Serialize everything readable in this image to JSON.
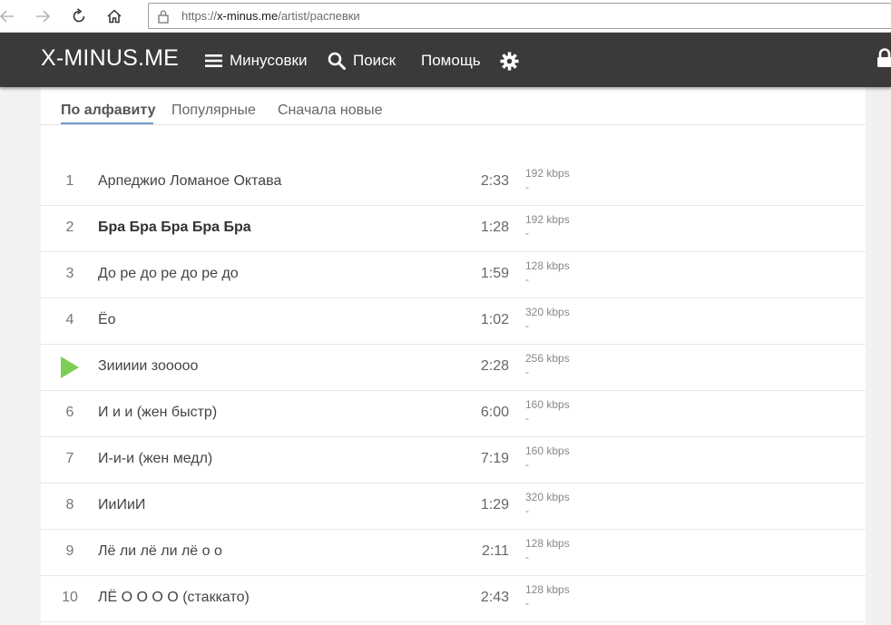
{
  "browser": {
    "url_scheme": "https://",
    "url_host": "x-minus.me",
    "url_path": "/artist/распевки"
  },
  "header": {
    "logo": "X-MINUS.ME",
    "nav": [
      {
        "label": "Минусовки",
        "icon": "menu-icon"
      },
      {
        "label": "Поиск",
        "icon": "search-icon"
      },
      {
        "label": "Помощь"
      }
    ],
    "settings_icon": "gear-icon",
    "lock_icon": "lock-icon"
  },
  "sort_tabs": [
    {
      "label": "По алфавиту",
      "active": true
    },
    {
      "label": "Популярные",
      "active": false
    },
    {
      "label": "Сначала новые",
      "active": false
    }
  ],
  "tracks": [
    {
      "num": "1",
      "title": "Арпеджио Ломаное Октава",
      "duration": "2:33",
      "bitrate": "192 kbps",
      "extra": "-",
      "bold": false,
      "playing": false
    },
    {
      "num": "2",
      "title": "Бра Бра Бра Бра Бра",
      "duration": "1:28",
      "bitrate": "192 kbps",
      "extra": "-",
      "bold": true,
      "playing": false
    },
    {
      "num": "3",
      "title": "До ре до ре до ре до",
      "duration": "1:59",
      "bitrate": "128 kbps",
      "extra": "-",
      "bold": false,
      "playing": false
    },
    {
      "num": "4",
      "title": "Ёо",
      "duration": "1:02",
      "bitrate": "320 kbps",
      "extra": "-",
      "bold": false,
      "playing": false
    },
    {
      "num": "",
      "title": "Зиииии зооооо",
      "duration": "2:28",
      "bitrate": "256 kbps",
      "extra": "-",
      "bold": false,
      "playing": true
    },
    {
      "num": "6",
      "title": "И и и (жен быстр)",
      "duration": "6:00",
      "bitrate": "160 kbps",
      "extra": "-",
      "bold": false,
      "playing": false
    },
    {
      "num": "7",
      "title": "И-и-и (жен медл)",
      "duration": "7:19",
      "bitrate": "160 kbps",
      "extra": "-",
      "bold": false,
      "playing": false
    },
    {
      "num": "8",
      "title": "ИиИиИ",
      "duration": "1:29",
      "bitrate": "320 kbps",
      "extra": "-",
      "bold": false,
      "playing": false
    },
    {
      "num": "9",
      "title": "Лё ли лё ли лё о о",
      "duration": "2:11",
      "bitrate": "128 kbps",
      "extra": "-",
      "bold": false,
      "playing": false
    },
    {
      "num": "10",
      "title": "ЛЁ О О О О (стаккато)",
      "duration": "2:43",
      "bitrate": "128 kbps",
      "extra": "-",
      "bold": false,
      "playing": false
    }
  ]
}
